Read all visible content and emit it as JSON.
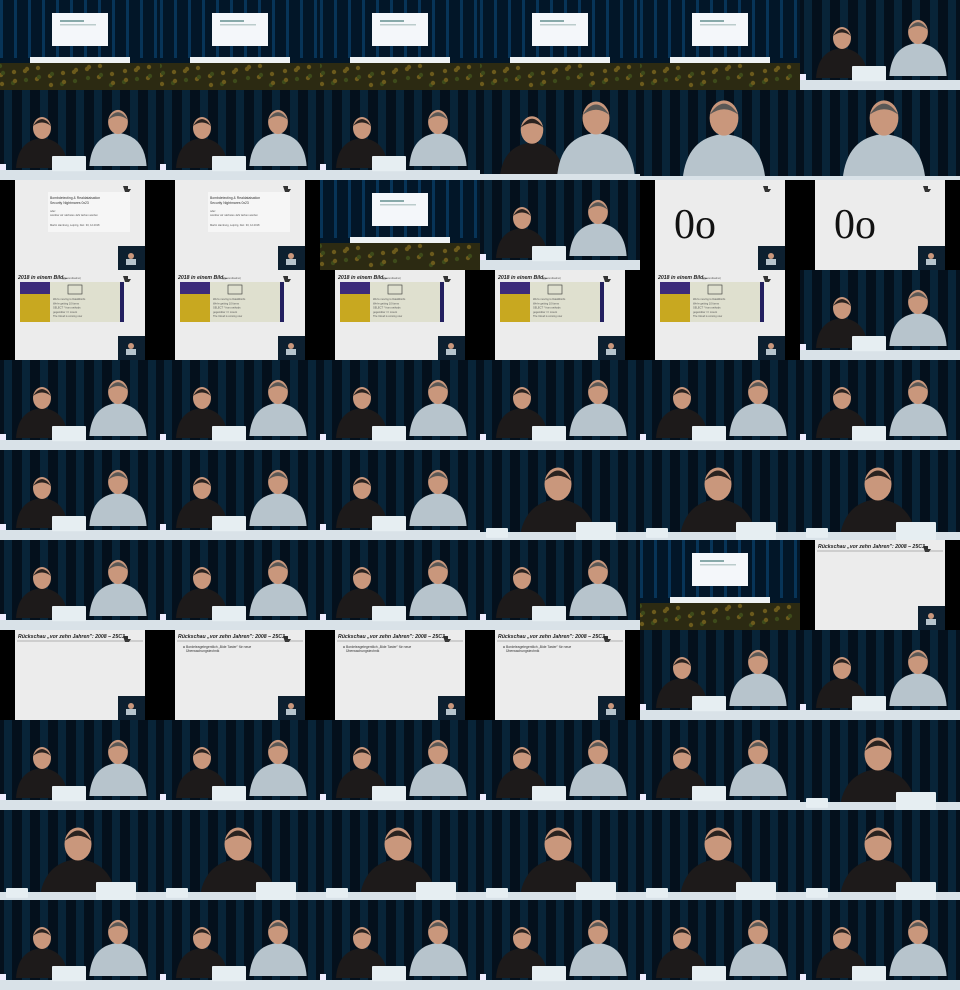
{
  "grid": {
    "columns": 6,
    "rows": 11
  },
  "slides": {
    "title_slide": {
      "title_line1": "Bombdetecting & Realdataisation",
      "title_line2": "Security Nightmares 0x23",
      "sub_line1": "oder:",
      "sub_line2": "worüber wir nächstes Jahr lachen werden",
      "footer": "Martin Hamburg, Leipzig, Dez. 30, 12.2018"
    },
    "oo_slide": {
      "text": "0o"
    },
    "photo_slide": {
      "title": "2018 in einem Bild...",
      "credit": "(@jsoundsalmo)",
      "note_lines": [
        "We're moving to DataWords",
        "We're getting 10 forms",
        "SELECT * from.sethods",
        "gegenüber == mount",
        "The Cloud is coming now"
      ]
    },
    "review_slide": {
      "title": "Rückschau „vor zehn Jahren\": 2008 – 25C3",
      "bullet1": "Bordeleagelegentlich „Bide Taster\" für neue",
      "bullet2": "Überwachungstechnik"
    }
  },
  "frames": [
    "stage",
    "stage",
    "stage",
    "stage",
    "stage",
    "duo",
    "duo",
    "duo",
    "duo",
    "duo_close",
    "guest_close",
    "guest_close",
    "title_slide",
    "title_slide",
    "stage",
    "duo",
    "oo_slide",
    "oo_slide",
    "photo_slide",
    "photo_slide",
    "photo_slide",
    "photo_slide",
    "photo_slide",
    "duo",
    "duo",
    "duo",
    "duo",
    "duo",
    "duo",
    "duo",
    "duo",
    "duo",
    "duo",
    "host_close",
    "host_close",
    "host_close",
    "duo",
    "duo",
    "duo",
    "duo",
    "stage",
    "review_slide",
    "review_slide",
    "review_slide_b",
    "review_slide_b",
    "review_slide_b",
    "duo",
    "duo",
    "duo",
    "duo",
    "duo",
    "duo",
    "duo",
    "host_close",
    "host_close",
    "host_close",
    "host_close",
    "host_close",
    "host_close",
    "host_close",
    "duo",
    "duo",
    "duo",
    "duo",
    "duo",
    "duo"
  ]
}
